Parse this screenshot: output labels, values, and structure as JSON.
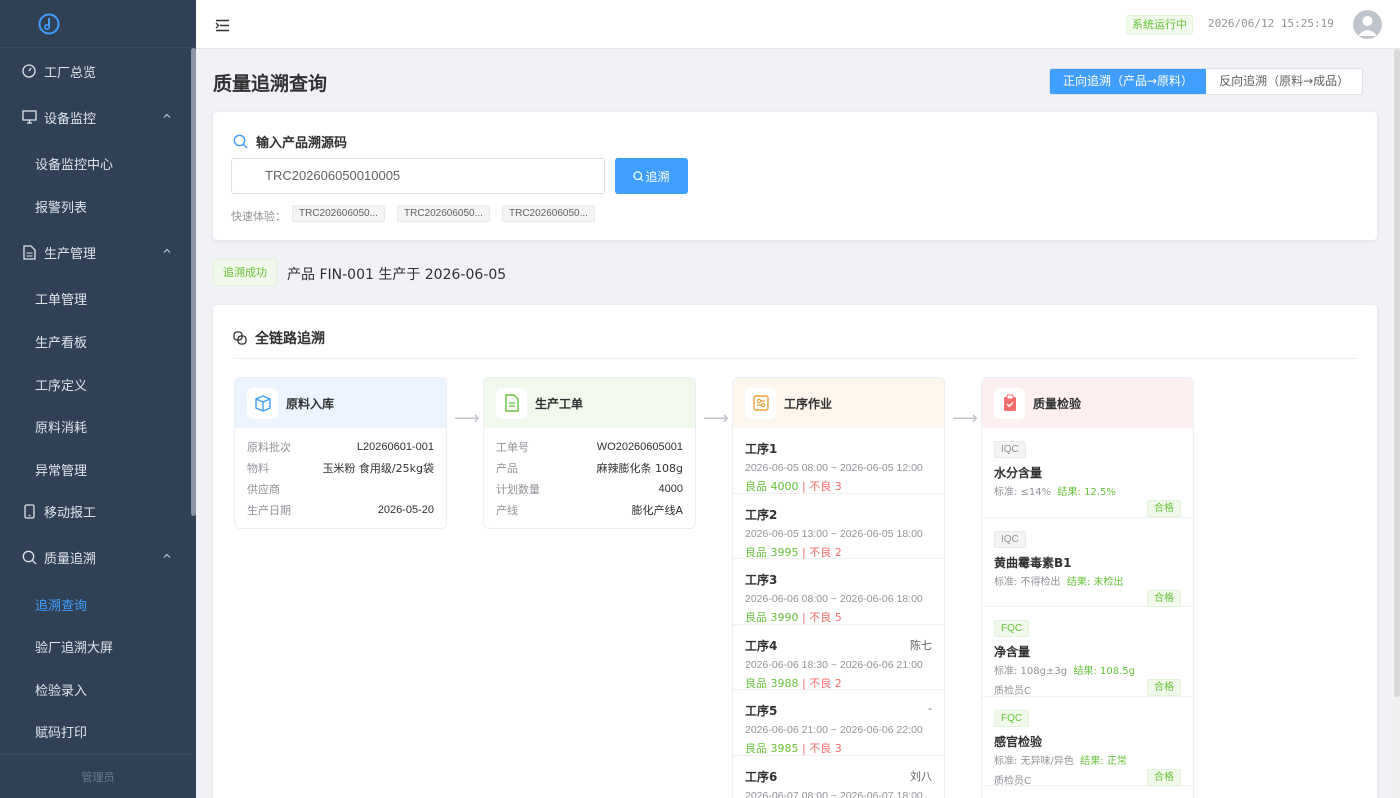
{
  "sidebar": {
    "footer": "管理员",
    "items": [
      {
        "label": "工厂总览"
      },
      {
        "label": "设备监控"
      },
      {
        "label": "生产管理"
      },
      {
        "label": "移动报工"
      },
      {
        "label": "质量追溯"
      }
    ],
    "sub": {
      "device": [
        "设备监控中心",
        "报警列表"
      ],
      "production": [
        "工单管理",
        "生产看板",
        "工序定义",
        "原料消耗",
        "异常管理"
      ],
      "quality": [
        "追溯查询",
        "验厂追溯大屏",
        "检验录入",
        "赋码打印"
      ]
    }
  },
  "header": {
    "status": "系统运行中",
    "clock": "2026/06/12 15:25:19"
  },
  "page": {
    "title": "质量追溯查询",
    "toggle": {
      "forward": "正向追溯（产品→原料）",
      "reverse": "反向追溯（原料→成品）"
    }
  },
  "search": {
    "title": "输入产品溯源码",
    "value": "TRC202606050010005",
    "button": "追溯",
    "quick_label": "快速体验：",
    "quick": [
      "TRC202606050...",
      "TRC202606050...",
      "TRC202606050..."
    ]
  },
  "result": {
    "tag": "追溯成功",
    "text": "产品 FIN-001 生产于 2026-06-05"
  },
  "chain": {
    "title": "全链路追溯",
    "material": {
      "title": "原料入库",
      "rows": [
        {
          "k": "原料批次",
          "v": "L20260601-001"
        },
        {
          "k": "物料",
          "v": "玉米粉 食用级/25kg袋"
        },
        {
          "k": "供应商",
          "v": ""
        },
        {
          "k": "生产日期",
          "v": "2026-05-20"
        }
      ]
    },
    "workorder": {
      "title": "生产工单",
      "rows": [
        {
          "k": "工单号",
          "v": "WO20260605001"
        },
        {
          "k": "产品",
          "v": "麻辣膨化条 108g"
        },
        {
          "k": "计划数量",
          "v": "4000"
        },
        {
          "k": "产线",
          "v": "膨化产线A"
        }
      ]
    },
    "process": {
      "title": "工序作业",
      "steps": [
        {
          "name": "工序1",
          "op": "",
          "time": "2026-06-05 08:00 ~ 2026-06-05 12:00",
          "good": "良品 4000",
          "sep": " | ",
          "bad": "不良 3"
        },
        {
          "name": "工序2",
          "op": "",
          "time": "2026-06-05 13:00 ~ 2026-06-05 18:00",
          "good": "良品 3995",
          "sep": " | ",
          "bad": "不良 2"
        },
        {
          "name": "工序3",
          "op": "",
          "time": "2026-06-06 08:00 ~ 2026-06-06 18:00",
          "good": "良品 3990",
          "sep": " | ",
          "bad": "不良 5"
        },
        {
          "name": "工序4",
          "op": "陈七",
          "time": "2026-06-06 18:30 ~ 2026-06-06 21:00",
          "good": "良品 3988",
          "sep": " | ",
          "bad": "不良 2"
        },
        {
          "name": "工序5",
          "op": "-",
          "time": "2026-06-06 21:00 ~ 2026-06-06 22:00",
          "good": "良品 3985",
          "sep": " | ",
          "bad": "不良 3"
        },
        {
          "name": "工序6",
          "op": "刘八",
          "time": "2026-06-07 08:00 ~ 2026-06-07 18:00",
          "good": "",
          "sep": "",
          "bad": ""
        }
      ]
    },
    "qc": {
      "title": "质量检验",
      "items": [
        {
          "tag": "IQC",
          "name": "水分含量",
          "std": "标准: ≤14%",
          "res": "结果: 12.5%",
          "inspector": "",
          "pass": "合格"
        },
        {
          "tag": "IQC",
          "name": "黄曲霉毒素B1",
          "std": "标准: 不得检出",
          "res": "结果: 未检出",
          "inspector": "",
          "pass": "合格"
        },
        {
          "tag": "FQC",
          "name": "净含量",
          "std": "标准: 108g±3g",
          "res": "结果: 108.5g",
          "inspector": "质检员C",
          "pass": "合格"
        },
        {
          "tag": "FQC",
          "name": "感官检验",
          "std": "标准: 无异味/异色",
          "res": "结果: 正常",
          "inspector": "质检员C",
          "pass": "合格"
        }
      ]
    }
  },
  "colors": {
    "sidebar": "#304156",
    "accent": "#409eff",
    "success": "#67c23a",
    "danger": "#f56c6c"
  }
}
